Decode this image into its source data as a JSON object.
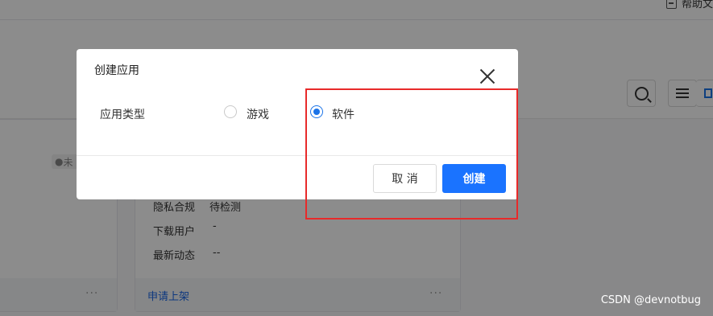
{
  "top_right": {
    "label": "帮助文"
  },
  "background": {
    "status_tag": "未",
    "rows": [
      {
        "label": "隐私合规",
        "value": "待检测"
      },
      {
        "label": "下载用户",
        "value": "-"
      },
      {
        "label": "最新动态",
        "value": "--"
      }
    ],
    "apply_link": "申请上架",
    "more": "···"
  },
  "dialog": {
    "title": "创建应用",
    "field_label": "应用类型",
    "options": [
      {
        "label": "游戏",
        "selected": false
      },
      {
        "label": "软件",
        "selected": true
      }
    ],
    "cancel_label": "取 消",
    "create_label": "创建"
  },
  "watermark": "CSDN @devnotbug",
  "colors": {
    "primary": "#1a73ff",
    "highlight": "#e82a2a"
  }
}
